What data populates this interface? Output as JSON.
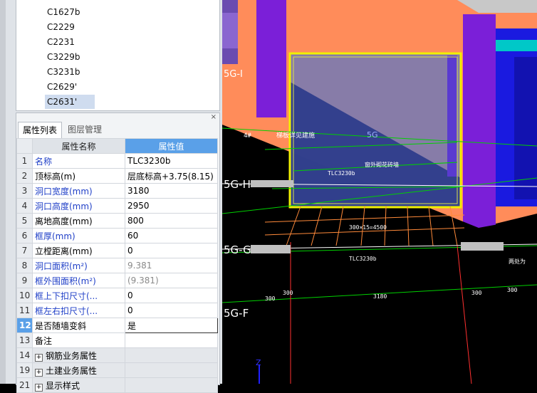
{
  "tree": {
    "items": [
      "C1627b",
      "C2229",
      "C2231",
      "C3229b",
      "C3231b",
      "C2629'",
      "C2631'"
    ],
    "selected_index": 6
  },
  "panel": {
    "close_label": "×",
    "tabs": [
      "属性列表",
      "图层管理"
    ],
    "columns": {
      "name": "属性名称",
      "value": "属性值"
    },
    "rows": [
      {
        "n": "1",
        "name": "名称",
        "value": "TLC3230b"
      },
      {
        "n": "2",
        "name": "顶标高(m)",
        "value": "层底标高+3.75(8.15)"
      },
      {
        "n": "3",
        "name": "洞口宽度(mm)",
        "value": "3180"
      },
      {
        "n": "4",
        "name": "洞口高度(mm)",
        "value": "2950"
      },
      {
        "n": "5",
        "name": "离地高度(mm)",
        "value": "800"
      },
      {
        "n": "6",
        "name": "框厚(mm)",
        "value": "60"
      },
      {
        "n": "7",
        "name": "立樘距离(mm)",
        "value": "0"
      },
      {
        "n": "8",
        "name": "洞口面积(m²)",
        "value": "9.381"
      },
      {
        "n": "9",
        "name": "框外围面积(m²)",
        "value": "(9.381)"
      },
      {
        "n": "10",
        "name": "框上下扣尺寸(...",
        "value": "0"
      },
      {
        "n": "11",
        "name": "框左右扣尺寸(...",
        "value": "0"
      },
      {
        "n": "12",
        "name": "是否随墙变斜",
        "value": "是"
      },
      {
        "n": "13",
        "name": "备注",
        "value": ""
      },
      {
        "n": "14",
        "name": "钢筋业务属性",
        "value": ""
      },
      {
        "n": "19",
        "name": "土建业务属性",
        "value": ""
      },
      {
        "n": "21",
        "name": "显示样式",
        "value": ""
      }
    ]
  },
  "viewport": {
    "axis_labels": [
      "5G-H",
      "5G-G",
      "5G-F",
      "5G-I"
    ],
    "annotations": [
      "4#",
      "梯板详见建施",
      "5G",
      "窗外砌花砖墙",
      "TLC3230b",
      "300×15=4500",
      "TLC3230b",
      "300",
      "300",
      "3180",
      "300",
      "300",
      "两处为"
    ],
    "axis_gizmo": "Z"
  },
  "colors": {
    "accent": "#5aa0e8",
    "blue_text": "#1f3fc7",
    "orange_wall": "#ff8c5a",
    "purple_column": "#7b1fd8",
    "cyan": "#00c8c8",
    "yellow_frame": "#f0f000"
  }
}
